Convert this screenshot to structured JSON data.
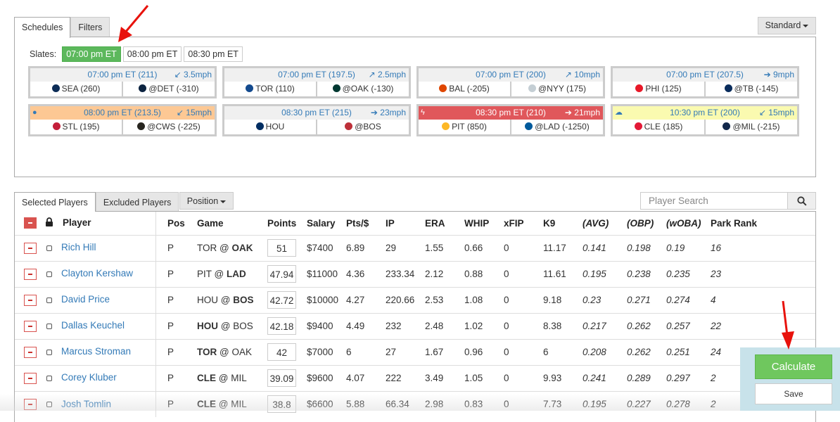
{
  "schedules": {
    "tabs": [
      {
        "label": "Schedules",
        "active": true
      },
      {
        "label": "Filters",
        "active": false
      }
    ],
    "mode_button": "Standard",
    "slates_label": "Slates:",
    "slates": [
      {
        "label": "07:00 pm ET",
        "active": true
      },
      {
        "label": "08:00 pm ET",
        "active": false
      },
      {
        "label": "08:30 pm ET",
        "active": false
      }
    ],
    "games": [
      {
        "time": "07:00 pm ET (211)",
        "wind": "3.5mph",
        "wind_icon": "arrow-down-left",
        "weather": "",
        "style": "normal",
        "away": "SEA (260)",
        "home": "@DET (-310)",
        "away_color": "#0c2c56",
        "home_color": "#0c2340"
      },
      {
        "time": "07:00 pm ET (197.5)",
        "wind": "2.5mph",
        "wind_icon": "arrow-up-right",
        "weather": "",
        "style": "normal",
        "away": "TOR (110)",
        "home": "@OAK (-130)",
        "away_color": "#134a8e",
        "home_color": "#003831"
      },
      {
        "time": "07:00 pm ET (200)",
        "wind": "10mph",
        "wind_icon": "arrow-up-right",
        "weather": "",
        "style": "normal",
        "away": "BAL (-205)",
        "home": "@NYY (175)",
        "away_color": "#df4601",
        "home_color": "#c4ced4"
      },
      {
        "time": "07:00 pm ET (207.5)",
        "wind": "9mph",
        "wind_icon": "arrow-right",
        "weather": "",
        "style": "normal",
        "away": "PHI (125)",
        "home": "@TB (-145)",
        "away_color": "#e81828",
        "home_color": "#092c5c"
      },
      {
        "time": "08:00 pm ET (213.5)",
        "wind": "15mph",
        "wind_icon": "arrow-down-left",
        "weather": "rain-drop-icon",
        "style": "orange",
        "away": "STL (195)",
        "home": "@CWS (-225)",
        "away_color": "#c41e3a",
        "home_color": "#27251f"
      },
      {
        "time": "08:30 pm ET (215)",
        "wind": "23mph",
        "wind_icon": "arrow-right",
        "weather": "",
        "style": "normal",
        "away": "HOU",
        "home": "@BOS",
        "away_color": "#002d62",
        "home_color": "#bd3039"
      },
      {
        "time": "08:30 pm ET (210)",
        "wind": "21mph",
        "wind_icon": "arrow-right",
        "weather": "lightning-icon",
        "style": "red",
        "away": "PIT (850)",
        "home": "@LAD (-1250)",
        "away_color": "#fdb827",
        "home_color": "#005a9c"
      },
      {
        "time": "10:30 pm ET (200)",
        "wind": "15mph",
        "wind_icon": "arrow-down-left",
        "weather": "cloud-icon",
        "style": "yellow",
        "away": "CLE (185)",
        "home": "@MIL (-215)",
        "away_color": "#e31937",
        "home_color": "#12284b"
      }
    ]
  },
  "players_panel": {
    "tabs": [
      {
        "label": "Selected Players",
        "active": true
      },
      {
        "label": "Excluded Players",
        "active": false
      }
    ],
    "position_button": "Position",
    "search_placeholder": "Player Search",
    "columns": [
      "Player",
      "Pos",
      "Game",
      "Points",
      "Salary",
      "Pts/$",
      "IP",
      "ERA",
      "WHIP",
      "xFIP",
      "K9",
      "(AVG)",
      "(OBP)",
      "(wOBA)",
      "Park Rank"
    ],
    "rows": [
      {
        "name": "Rich Hill",
        "pos": "P",
        "away": "TOR",
        "home": "OAK",
        "bold": "home",
        "points": "51",
        "salary": "$7400",
        "pts_per": "6.89",
        "ip": "29",
        "era": "1.55",
        "whip": "0.66",
        "xfip": "0",
        "k9": "11.17",
        "avg": "0.141",
        "obp": "0.198",
        "woba": "0.19",
        "park": "16"
      },
      {
        "name": "Clayton Kershaw",
        "pos": "P",
        "away": "PIT",
        "home": "LAD",
        "bold": "home",
        "points": "47.94",
        "salary": "$11000",
        "pts_per": "4.36",
        "ip": "233.34",
        "era": "2.12",
        "whip": "0.88",
        "xfip": "0",
        "k9": "11.61",
        "avg": "0.195",
        "obp": "0.238",
        "woba": "0.235",
        "park": "23"
      },
      {
        "name": "David Price",
        "pos": "P",
        "away": "HOU",
        "home": "BOS",
        "bold": "home",
        "points": "42.72",
        "salary": "$10000",
        "pts_per": "4.27",
        "ip": "220.66",
        "era": "2.53",
        "whip": "1.08",
        "xfip": "0",
        "k9": "9.18",
        "avg": "0.23",
        "obp": "0.271",
        "woba": "0.274",
        "park": "4"
      },
      {
        "name": "Dallas Keuchel",
        "pos": "P",
        "away": "HOU",
        "home": "BOS",
        "bold": "away",
        "points": "42.18",
        "salary": "$9400",
        "pts_per": "4.49",
        "ip": "232",
        "era": "2.48",
        "whip": "1.02",
        "xfip": "0",
        "k9": "8.38",
        "avg": "0.217",
        "obp": "0.262",
        "woba": "0.257",
        "park": "22"
      },
      {
        "name": "Marcus Stroman",
        "pos": "P",
        "away": "TOR",
        "home": "OAK",
        "bold": "away",
        "points": "42",
        "salary": "$7000",
        "pts_per": "6",
        "ip": "27",
        "era": "1.67",
        "whip": "0.96",
        "xfip": "0",
        "k9": "6",
        "avg": "0.208",
        "obp": "0.262",
        "woba": "0.251",
        "park": "24"
      },
      {
        "name": "Corey Kluber",
        "pos": "P",
        "away": "CLE",
        "home": "MIL",
        "bold": "away",
        "points": "39.09",
        "salary": "$9600",
        "pts_per": "4.07",
        "ip": "222",
        "era": "3.49",
        "whip": "1.05",
        "xfip": "0",
        "k9": "9.93",
        "avg": "0.241",
        "obp": "0.289",
        "woba": "0.297",
        "park": "2"
      },
      {
        "name": "Josh Tomlin",
        "pos": "P",
        "away": "CLE",
        "home": "MIL",
        "bold": "away",
        "points": "38.8",
        "salary": "$6600",
        "pts_per": "5.88",
        "ip": "66.34",
        "era": "2.98",
        "whip": "0.83",
        "xfip": "0",
        "k9": "7.73",
        "avg": "0.195",
        "obp": "0.227",
        "woba": "0.278",
        "park": "2"
      }
    ]
  },
  "actions": {
    "calculate": "Calculate",
    "save": "Save"
  },
  "colors": {
    "active_green": "#5cb85c",
    "link_blue": "#337ab7",
    "remove_red": "#d9534f",
    "annotation_red": "#e8120c"
  }
}
